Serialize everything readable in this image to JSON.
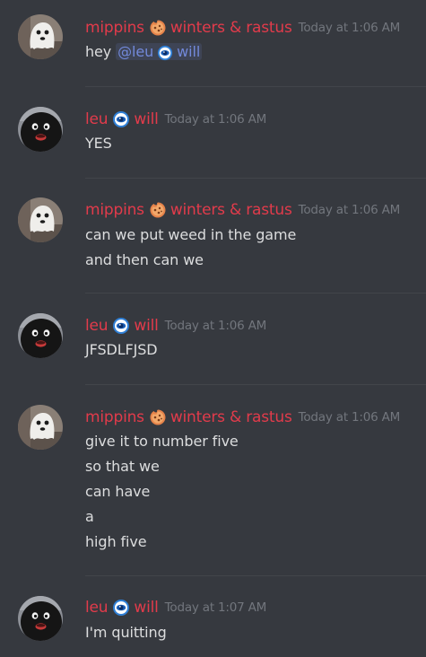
{
  "users": {
    "mippins": {
      "name_left": "mippins",
      "name_right": "winters & rastus",
      "sep_icon": "cookie-icon",
      "color": "#e23b4b"
    },
    "leu": {
      "name_left": "leu",
      "name_right": "will",
      "sep_icon": "blue-eye-icon",
      "color": "#e23b4b"
    }
  },
  "messages": [
    {
      "user": "mippins",
      "author_left": "mippins",
      "author_right": "winters & rastus",
      "timestamp": "Today at 1:06 AM",
      "prefix": "hey ",
      "mention_left": "@leu",
      "mention_right": "will",
      "lines": []
    },
    {
      "user": "leu",
      "author_left": "leu",
      "author_right": "will",
      "timestamp": "Today at 1:06 AM",
      "lines": [
        "YES"
      ]
    },
    {
      "user": "mippins",
      "author_left": "mippins",
      "author_right": "winters & rastus",
      "timestamp": "Today at 1:06 AM",
      "lines": [
        "can we put weed in the game",
        "and then can we"
      ]
    },
    {
      "user": "leu",
      "author_left": "leu",
      "author_right": "will",
      "timestamp": "Today at 1:06 AM",
      "lines": [
        "JFSDLFJSD"
      ]
    },
    {
      "user": "mippins",
      "author_left": "mippins",
      "author_right": "winters & rastus",
      "timestamp": "Today at 1:06 AM",
      "lines": [
        "give it to number five",
        "so that we",
        "can have",
        "a",
        "high five"
      ]
    },
    {
      "user": "leu",
      "author_left": "leu",
      "author_right": "will",
      "timestamp": "Today at 1:07 AM",
      "lines": [
        "I'm quitting"
      ]
    }
  ]
}
